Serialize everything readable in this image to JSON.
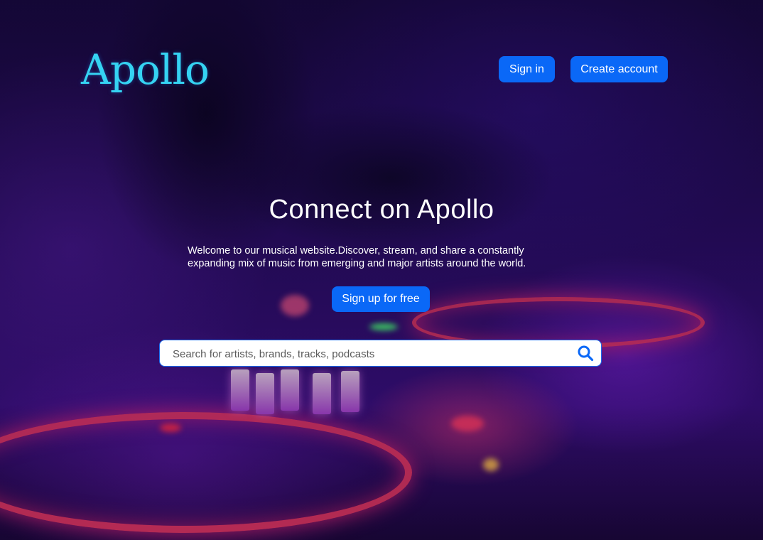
{
  "brand": {
    "logo_text": "Apollo"
  },
  "header": {
    "sign_in_label": "Sign in",
    "create_account_label": "Create account"
  },
  "hero": {
    "title": "Connect on Apollo",
    "subtitle_line1": "Welcome to our musical website.Discover, stream, and share a constantly",
    "subtitle_line2": "expanding mix of music from emerging and major artists around the world.",
    "cta_label": "Sign up for free"
  },
  "search": {
    "placeholder": "Search for artists, brands, tracks, podcasts",
    "value": "",
    "icon": "search-icon"
  },
  "colors": {
    "accent": "#0a68f7",
    "logo": "#35d3f2",
    "background": "#2a0d66"
  }
}
